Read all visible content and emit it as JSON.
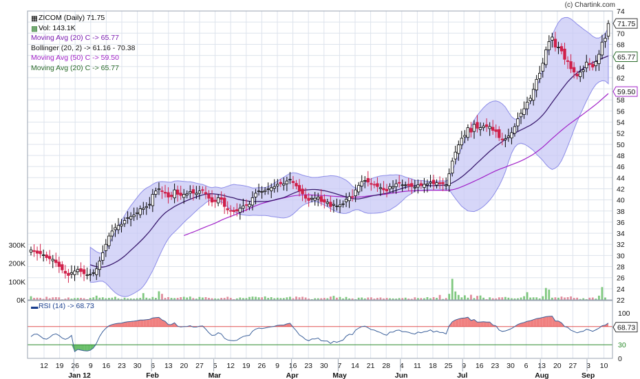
{
  "watermark": "(c) Chartink.com",
  "legend": {
    "price": "ZICOM (Daily) 71.75",
    "vol": "Vol: 143.1K",
    "ma20": "Moving Avg (20) C -> 65.77",
    "bollinger": "Bollinger (20, 2) -> 61.16 - 70.38",
    "ma50": "Moving Avg (50) C -> 59.50",
    "ma20b": "Moving Avg (20) C -> 65.77",
    "rsi": "RSI (14) -> 68.73"
  },
  "colors": {
    "up": "#ffffff",
    "down": "#d0204a",
    "wick": "#000000",
    "ma20": "#3a1a6e",
    "ma50": "#a020c8",
    "band_fill": "#c8c8f5",
    "band_line": "#8c8ce8",
    "vol_up": "#7fc87f",
    "vol_down": "#e08c9c",
    "rsi": "#3a5f9a",
    "rsi_hot": "#f08080",
    "ma20_legend": "#1a1a8c",
    "ma50_legend": "#a020c8",
    "ma20b_legend": "#2a6a2a"
  },
  "chart_data": {
    "type": "candlestick",
    "title": "ZICOM (Daily) 71.75",
    "price_axis": {
      "min": 22,
      "max": 74,
      "ticks": [
        22,
        24,
        26,
        28,
        30,
        32,
        34,
        36,
        38,
        40,
        42,
        44,
        46,
        48,
        50,
        52,
        54,
        56,
        58,
        60,
        62,
        64,
        66,
        68,
        70,
        72,
        74
      ]
    },
    "volume_axis": {
      "min": 0,
      "max": 300000,
      "ticks": [
        "0K",
        "100K",
        "200K",
        "300K"
      ]
    },
    "rsi_axis": {
      "min": 0,
      "max": 100,
      "ticks": [
        0,
        30,
        70,
        100
      ],
      "levels": [
        30,
        70
      ]
    },
    "price_badges": [
      "71.75",
      "65.77",
      "59.50"
    ],
    "rsi_badges": [
      "68.73",
      "30"
    ],
    "x_labels": [
      "12",
      "19",
      "26",
      "9",
      "16",
      "23",
      "30",
      "6",
      "13",
      "20",
      "27",
      "5",
      "12",
      "19",
      "26",
      "9",
      "16",
      "23",
      "30",
      "7",
      "14",
      "21",
      "28",
      "4",
      "11",
      "18",
      "25",
      "9",
      "16",
      "23",
      "30",
      "6",
      "13",
      "20",
      "27",
      "3",
      "10"
    ],
    "month_labels": [
      "Jan 12",
      "Feb",
      "Mar",
      "Apr",
      "May",
      "Jun",
      "Jul",
      "Aug",
      "Sep"
    ],
    "closes": [
      31.0,
      30.7,
      30.4,
      30.3,
      30.1,
      29.6,
      29.4,
      29.3,
      28.7,
      28.0,
      27.4,
      26.8,
      26.4,
      26.9,
      27.2,
      27.5,
      27.1,
      26.7,
      26.5,
      26.6,
      26.9,
      27.6,
      29.0,
      30.5,
      32.0,
      33.5,
      34.4,
      35.0,
      35.4,
      35.6,
      36.3,
      36.8,
      37.0,
      37.3,
      37.7,
      38.4,
      38.5,
      38.8,
      39.2,
      41.0,
      41.6,
      42.0,
      41.5,
      41.2,
      40.5,
      40.6,
      41.8,
      41.0,
      40.8,
      41.0,
      41.1,
      41.5,
      41.2,
      41.2,
      41.6,
      41.7,
      41.1,
      40.3,
      39.6,
      39.7,
      40.4,
      40.1,
      38.8,
      38.2,
      38.0,
      37.9,
      38.0,
      38.5,
      38.9,
      39.1,
      39.2,
      40.4,
      41.2,
      41.6,
      41.5,
      41.7,
      42.0,
      42.2,
      42.4,
      42.8,
      42.9,
      42.9,
      43.4,
      43.7,
      43.1,
      42.5,
      41.6,
      41.1,
      40.3,
      39.9,
      40.3,
      40.3,
      40.5,
      39.7,
      39.6,
      39.6,
      38.8,
      39.2,
      38.9,
      39.1,
      39.3,
      40.1,
      40.6,
      40.5,
      41.8,
      42.6,
      43.3,
      43.5,
      43.2,
      42.8,
      42.7,
      42.4,
      42.2,
      41.8,
      41.6,
      42.4,
      42.4,
      42.9,
      43.0,
      42.7,
      42.7,
      42.6,
      42.4,
      42.3,
      42.7,
      42.6,
      42.8,
      42.9,
      43.2,
      42.9,
      43.1,
      42.9,
      42.9,
      42.7,
      44.7,
      47.0,
      48.6,
      49.9,
      51.1,
      51.6,
      53.0,
      52.2,
      53.6,
      52.9,
      53.0,
      53.3,
      53.2,
      53.2,
      52.5,
      52.3,
      51.2,
      50.8,
      51.0,
      51.5,
      52.1,
      53.2,
      54.6,
      55.6,
      56.4,
      57.6,
      58.3,
      59.9,
      61.7,
      62.8,
      64.6,
      67.0,
      68.5,
      69.3,
      67.5,
      67.5,
      66.8,
      65.3,
      64.9,
      63.6,
      63.0,
      62.3,
      63.0,
      63.4,
      64.8,
      64.4,
      63.9,
      64.9,
      66.2,
      68.4,
      69.1,
      71.75
    ],
    "volume_k": [
      20,
      11,
      12,
      11,
      6,
      17,
      9,
      14,
      15,
      14,
      3,
      7,
      13,
      7,
      10,
      11,
      11,
      9,
      4,
      11,
      14,
      23,
      12,
      14,
      9,
      11,
      12,
      17,
      8,
      5,
      12,
      8,
      8,
      7,
      9,
      11,
      37,
      12,
      8,
      16,
      11,
      47,
      33,
      11,
      15,
      11,
      10,
      11,
      15,
      17,
      13,
      18,
      10,
      7,
      16,
      13,
      15,
      11,
      9,
      8,
      7,
      11,
      11,
      17,
      11,
      4,
      8,
      13,
      10,
      10,
      16,
      18,
      17,
      14,
      14,
      19,
      11,
      15,
      9,
      12,
      10,
      10,
      14,
      17,
      9,
      18,
      14,
      17,
      13,
      7,
      4,
      9,
      9,
      9,
      11,
      9,
      18,
      22,
      12,
      16,
      8,
      16,
      8,
      8,
      4,
      12,
      13,
      8,
      13,
      14,
      7,
      11,
      13,
      8,
      11,
      9,
      8,
      7,
      10,
      10,
      12,
      7,
      6,
      14,
      10,
      10,
      9,
      15,
      9,
      15,
      11,
      27,
      5,
      10,
      33,
      115,
      46,
      27,
      14,
      25,
      12,
      28,
      10,
      22,
      24,
      12,
      4,
      14,
      9,
      8,
      14,
      14,
      16,
      12,
      9,
      8,
      9,
      13,
      20,
      42,
      13,
      14,
      14,
      8,
      20,
      65,
      56,
      12,
      14,
      12,
      18,
      13,
      15,
      19,
      11,
      12,
      5,
      9,
      4,
      12,
      13,
      7,
      23,
      70,
      13
    ]
  }
}
